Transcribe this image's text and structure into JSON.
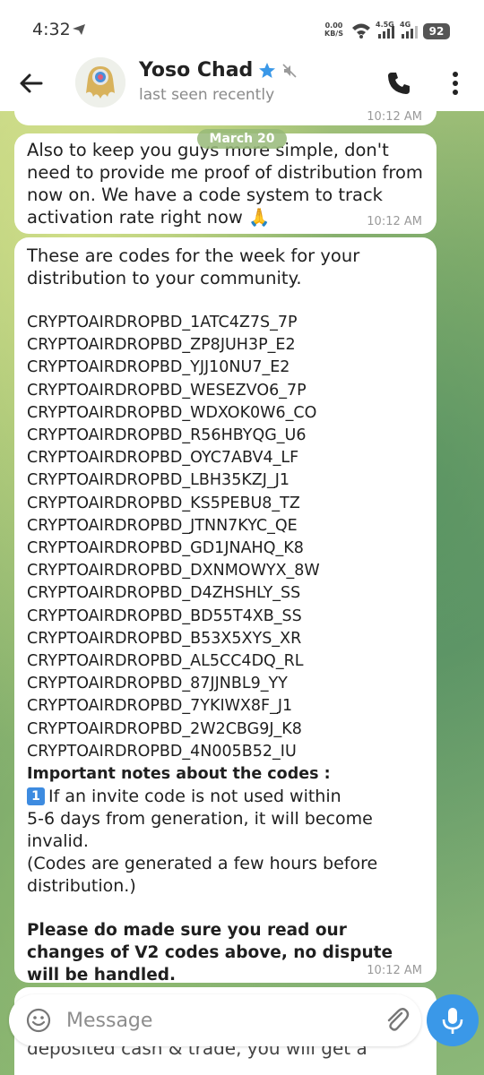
{
  "status_bar": {
    "time": "4:32",
    "net_speed_value": "0.00",
    "net_speed_unit": "KB/S",
    "signal1_label": "4.5G",
    "signal2_label": "4G",
    "battery": "92"
  },
  "header": {
    "name": "Yoso Chad",
    "status": "last seen recently"
  },
  "chat": {
    "prev_message_time": "10:12 AM",
    "date_label": "March 20",
    "message1": {
      "text": "Also to keep you guys more simple, don't need to provide me proof of distribution from now on. We have a code system to track activation rate right now 🙏",
      "time": "10:12 AM"
    },
    "message2": {
      "intro": "These are codes for the week for your distribution to your community.",
      "codes": [
        "CRYPTOAIRDROPBD_1ATC4Z7S_7P",
        "CRYPTOAIRDROPBD_ZP8JUH3P_E2",
        "CRYPTOAIRDROPBD_YJJ10NU7_E2",
        "CRYPTOAIRDROPBD_WESEZVO6_7P",
        "CRYPTOAIRDROPBD_WDXOK0W6_CO",
        "CRYPTOAIRDROPBD_R56HBYQG_U6",
        "CRYPTOAIRDROPBD_OYC7ABV4_LF",
        "CRYPTOAIRDROPBD_LBH35KZJ_J1",
        "CRYPTOAIRDROPBD_KS5PEBU8_TZ",
        "CRYPTOAIRDROPBD_JTNN7KYC_QE",
        "CRYPTOAIRDROPBD_GD1JNAHQ_K8",
        "CRYPTOAIRDROPBD_DXNMOWYX_8W",
        "CRYPTOAIRDROPBD_D4ZHSHLY_SS",
        "CRYPTOAIRDROPBD_BD55T4XB_SS",
        "CRYPTOAIRDROPBD_B53X5XYS_XR",
        "CRYPTOAIRDROPBD_AL5CC4DQ_RL",
        "CRYPTOAIRDROPBD_87JJNBL9_YY",
        "CRYPTOAIRDROPBD_7YKIWX8F_J1",
        "CRYPTOAIRDROPBD_2W2CBG9J_K8",
        "CRYPTOAIRDROPBD_4N005B52_IU"
      ],
      "notes_title": "Important notes about the codes :",
      "note_number": "1",
      "note_lines": [
        "If an invite code is not used within",
        "5-6 days from generation, it will become",
        "invalid.",
        "(Codes are generated a few hours before",
        "distribution.)"
      ],
      "warning": "Please do made sure you read our changes of V2 codes above, no dispute will be handled.",
      "time": "10:12 AM"
    },
    "partial_message": "deposited cash & trade, you will get a"
  },
  "input": {
    "placeholder": "Message"
  },
  "colors": {
    "accent": "#3a98e8",
    "star": "#3a98e8"
  }
}
